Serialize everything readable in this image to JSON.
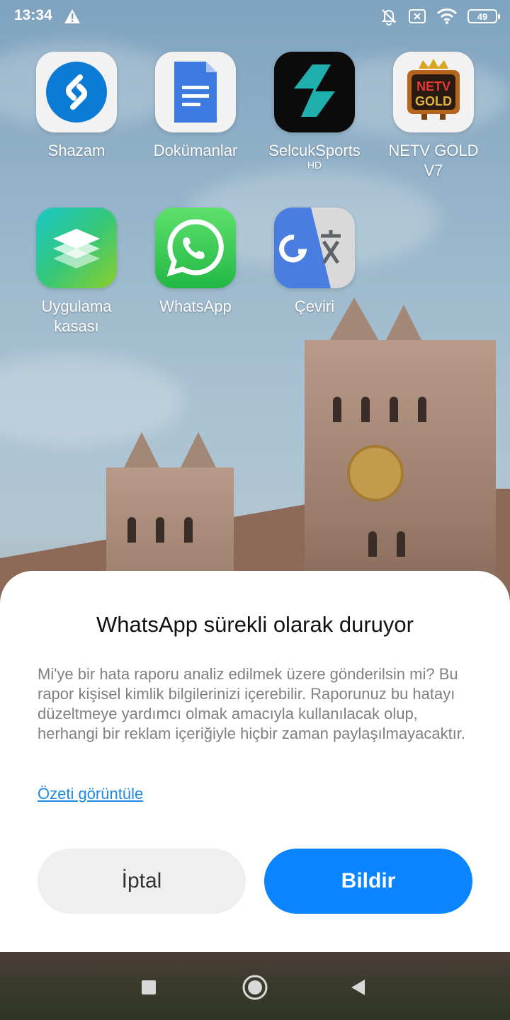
{
  "status_bar": {
    "time": "13:34",
    "battery": "49",
    "icons": [
      "warning-icon",
      "bell-off-icon",
      "sim-off-icon",
      "wifi-icon",
      "battery-icon"
    ]
  },
  "apps": [
    {
      "label": "Shazam",
      "icon": "shazam-icon",
      "color": "#0b7bd5"
    },
    {
      "label": "Dokümanlar",
      "icon": "google-docs-icon",
      "color": "#3d7ae0"
    },
    {
      "label": "SelcukSports",
      "sublabel": "HD",
      "icon": "selcuksports-icon",
      "color": "#1fb0ae"
    },
    {
      "label": "NETV GOLD V7",
      "icon": "netv-gold-icon",
      "color": "#d7232a"
    },
    {
      "label": "Uygulama kasası",
      "icon": "app-vault-icon",
      "color": "#2ecf8c"
    },
    {
      "label": "WhatsApp",
      "icon": "whatsapp-icon",
      "color": "#25d366"
    },
    {
      "label": "Çeviri",
      "icon": "google-translate-icon",
      "color": "#4a7de0"
    }
  ],
  "netv_logo": {
    "line1": "NETV",
    "line2": "GOLD"
  },
  "dialog": {
    "title": "WhatsApp sürekli olarak duruyor",
    "body": "Mi'ye bir hata raporu analiz edilmek üzere gönderilsin mi? Bu rapor kişisel kimlik bilgilerinizi içerebilir. Raporunuz bu hatayı düzeltmeye yardımcı olmak amacıyla kullanılacak olup, herhangi bir reklam içeriğiyle hiçbir zaman paylaşılmayacaktır.",
    "link": "Özeti görüntüle",
    "cancel_label": "İptal",
    "report_label": "Bildir",
    "accent_color": "#0a84ff"
  },
  "nav_bar": {
    "buttons": [
      "recents-icon",
      "home-icon",
      "back-icon"
    ]
  }
}
